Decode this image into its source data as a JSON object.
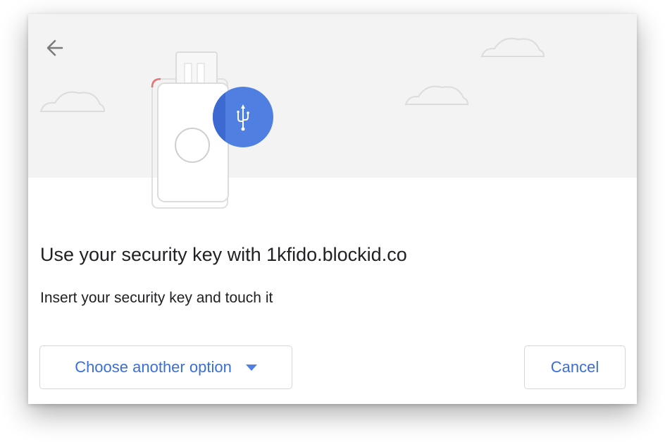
{
  "dialog": {
    "title": "Use your security key with 1kfido.blockid.co",
    "instruction": "Insert your security key and touch it",
    "back_icon": "arrow-left-icon",
    "illustration_icons": [
      "cloud-icon",
      "security-key-icon",
      "usb-icon"
    ]
  },
  "buttons": {
    "another_option": "Choose another option",
    "another_option_icon": "caret-down-icon",
    "cancel": "Cancel"
  },
  "colors": {
    "accent_blue": "#4f7fe0",
    "illustration_background": "#f3f3f3",
    "title_text": "#202124",
    "button_text": "#3a6fd6",
    "key_indicator_red": "#e57373"
  }
}
